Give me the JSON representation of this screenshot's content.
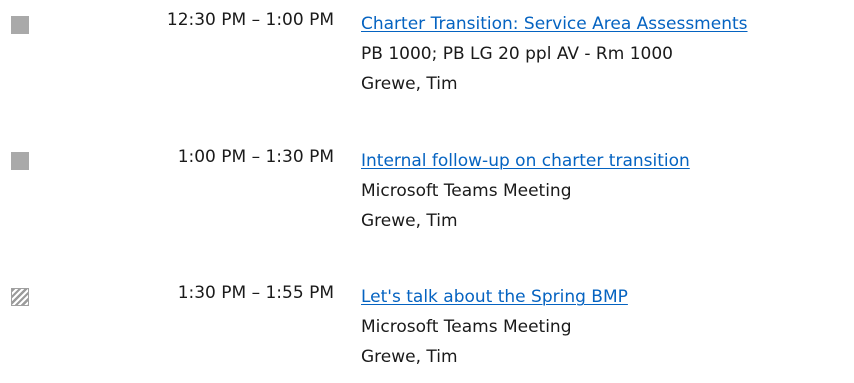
{
  "events": [
    {
      "status": "busy",
      "status_icon": "busy-status-icon",
      "status_color": "#a9a9a9",
      "time": "12:30 PM – 1:00 PM",
      "title": "Charter Transition: Service Area Assessments",
      "location": "PB 1000; PB LG 20 ppl AV - Rm 1000",
      "organizer": "Grewe, Tim"
    },
    {
      "status": "busy",
      "status_icon": "busy-status-icon",
      "status_color": "#a9a9a9",
      "time": "1:00 PM – 1:30 PM",
      "title": "Internal follow-up on charter transition",
      "location": "Microsoft Teams Meeting",
      "organizer": "Grewe, Tim"
    },
    {
      "status": "tentative",
      "status_icon": "tentative-status-icon",
      "status_color": "#9b9b9b",
      "time": "1:30 PM – 1:55 PM",
      "title": "Let's talk about the Spring BMP",
      "location": "Microsoft Teams Meeting",
      "organizer": "Grewe, Tim"
    }
  ],
  "link_color": "#0563c1",
  "text_color": "#1a1a1a"
}
